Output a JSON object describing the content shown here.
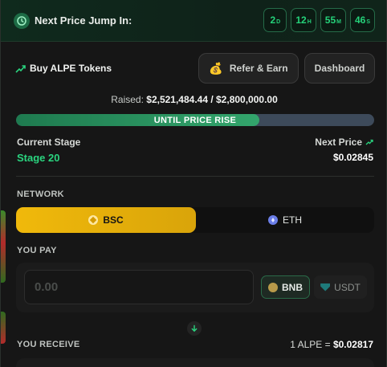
{
  "topbar": {
    "title": "Next Price Jump In:",
    "timer": [
      {
        "value": "2",
        "unit": "D"
      },
      {
        "value": "12",
        "unit": "H"
      },
      {
        "value": "55",
        "unit": "M"
      },
      {
        "value": "46",
        "unit": "S"
      }
    ]
  },
  "header": {
    "buy_title": "Buy ALPE Tokens",
    "refer_label": "Refer & Earn",
    "dashboard_label": "Dashboard"
  },
  "raised": {
    "prefix": "Raised:",
    "amount": "$2,521,484.44 / $2,800,000.00",
    "progress_fraction": 0.68,
    "progress_label": "UNTIL PRICE RISE"
  },
  "stage": {
    "current_label": "Current Stage",
    "current_value": "Stage 20",
    "next_label": "Next Price",
    "next_value": "$0.02845"
  },
  "network": {
    "label": "NETWORK",
    "options": [
      "BSC",
      "ETH"
    ],
    "selected": "BSC"
  },
  "pay": {
    "label": "YOU PAY",
    "placeholder": "0.00",
    "tokens": [
      "BNB",
      "USDT"
    ],
    "selected_token": "BNB"
  },
  "receive": {
    "label": "YOU RECEIVE",
    "rate_prefix": "1 ALPE =",
    "rate_value": "$0.02817"
  },
  "colors": {
    "accent_green": "#2ad47f",
    "bsc_yellow": "#f0b90b",
    "progress_green": "#1e7a4f"
  }
}
